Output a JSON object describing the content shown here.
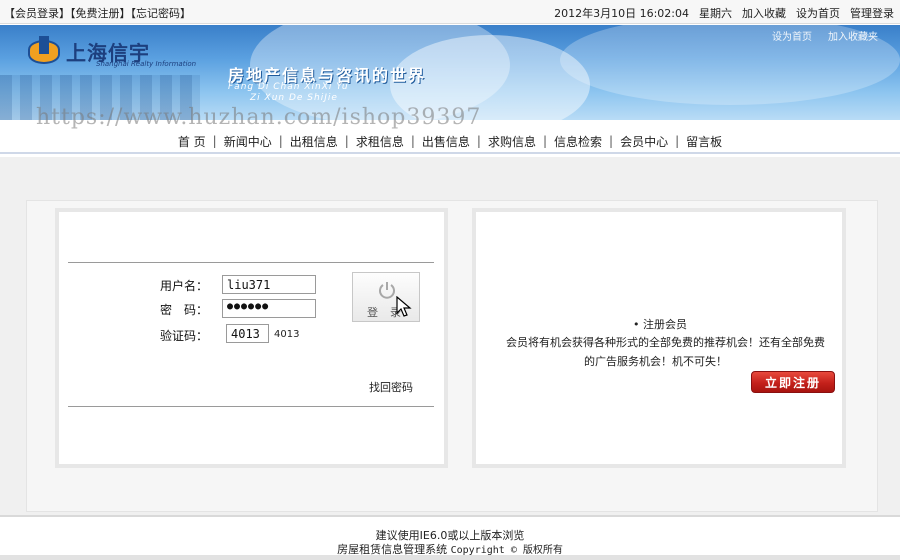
{
  "topbar": {
    "member_login": "【会员登录】",
    "free_register": "【免费注册】",
    "forgot_password": "【忘记密码】",
    "datetime": "2012年3月10日 16:02:04",
    "weekday": "星期六",
    "add_favorite": "加入收藏",
    "set_homepage": "设为首页",
    "admin_login": "管理登录"
  },
  "banner": {
    "logo_text": "上海信宇",
    "logo_sub": "Shanghai Realty Information",
    "slogan": "房地产信息与咨讯的世界",
    "pinyin1": "Fang Di Chan XinXi Yu",
    "pinyin2": "Zi Xun De ShiJie",
    "link1": "设为首页",
    "link2": "加入收藏夹"
  },
  "watermark": "https://www.huzhan.com/ishop39397",
  "nav": {
    "items": [
      "首 页",
      "新闻中心",
      "出租信息",
      "求租信息",
      "出售信息",
      "求购信息",
      "信息检索",
      "会员中心",
      "留言板"
    ]
  },
  "login": {
    "username_label": "用户名：",
    "username_value": "liu371",
    "password_label": "密　码：",
    "password_value": "●●●●●●",
    "captcha_label": "验证码：",
    "captcha_value": "4013",
    "captcha_image_text": "4013",
    "login_button": "登录",
    "forgot_link": "找回密码"
  },
  "register": {
    "title": "• 注册会员",
    "line1": "会员将有机会获得各种形式的全部免费的推荐机会！还有全部免费",
    "line2": "的广告服务机会！机不可失！",
    "button": "立即注册"
  },
  "footer": {
    "line1": "建议使用IE6.0或以上版本浏览",
    "line2_text": "房屋租赁信息管理系统",
    "line2_copy": "Copyright © 版权所有"
  }
}
